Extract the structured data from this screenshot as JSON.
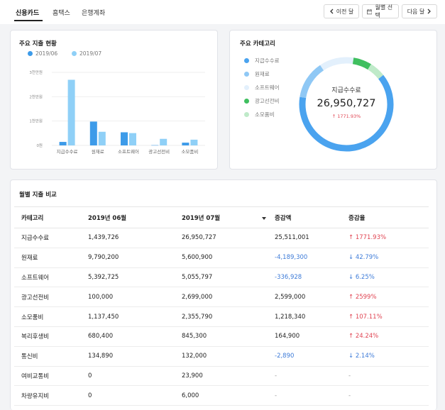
{
  "tabs": [
    {
      "label": "신용카드",
      "active": true
    },
    {
      "label": "흠택스",
      "active": false
    },
    {
      "label": "은행계좌",
      "active": false
    }
  ],
  "toolbar": {
    "prev_label": "이전 달",
    "month_select_label": "월별 선택",
    "next_label": "다음 달",
    "prev_icon": "chevron-left-icon",
    "calendar_icon": "calendar-icon",
    "next_icon": "chevron-right-icon"
  },
  "spending_card": {
    "title": "주요 지출 현황",
    "chart_data": {
      "type": "bar",
      "title": "주요 지출 현황",
      "categories": [
        "지급수수료",
        "원재료",
        "소프트웨어",
        "광고선전비",
        "소모품비"
      ],
      "series": [
        {
          "name": "2019/06",
          "color": "#3d9be9",
          "values": [
            1439726,
            9790200,
            5392725,
            100000,
            1137450
          ]
        },
        {
          "name": "2019/07",
          "color": "#8fd0f7",
          "values": [
            26950727,
            5600900,
            5055797,
            2699000,
            2355790
          ]
        }
      ],
      "y_ticks": [
        {
          "value": 0,
          "label": "0원"
        },
        {
          "value": 10000000,
          "label": "1천만원"
        },
        {
          "value": 20000000,
          "label": "2천만원"
        },
        {
          "value": 30000000,
          "label": "3천만원"
        }
      ],
      "ylim": [
        0,
        30000000
      ],
      "grid": true,
      "legend": "top-left"
    }
  },
  "category_card": {
    "title": "주요 카테고리",
    "items": [
      {
        "label": "지급수수료",
        "color": "#4aa3ef"
      },
      {
        "label": "원재료",
        "color": "#8fc8f5"
      },
      {
        "label": "소프트웨어",
        "color": "#e3f0fc"
      },
      {
        "label": "광고선전비",
        "color": "#3fbf5f"
      },
      {
        "label": "소모품비",
        "color": "#bfeac9"
      }
    ],
    "center_label": "지급수수료",
    "center_value": "26,950,727",
    "center_change": "↑ 1771.93%",
    "chart_data": {
      "type": "pie",
      "categories": [
        "지급수수료",
        "원재료",
        "소프트웨어",
        "광고선전비",
        "소모품비"
      ],
      "values": [
        26950727,
        5600900,
        5055797,
        2699000,
        2355790
      ],
      "colors": [
        "#4aa3ef",
        "#8fc8f5",
        "#e3f0fc",
        "#3fbf5f",
        "#bfeac9"
      ]
    }
  },
  "compare_card": {
    "title": "월별 지출 비교",
    "headers": [
      "카테고리",
      "2019년 06월",
      "2019년 07월",
      "증감액",
      "증감율"
    ],
    "sort_icon": "caret-down-icon",
    "rows": [
      {
        "category": "지급수수료",
        "jun": "1,439,726",
        "jul": "26,950,727",
        "diff": "25,511,001",
        "diff_neg": false,
        "rate": "↑ 1771.93%",
        "rate_dir": "up"
      },
      {
        "category": "원재료",
        "jun": "9,790,200",
        "jul": "5,600,900",
        "diff": "-4,189,300",
        "diff_neg": true,
        "rate": "↓ 42.79%",
        "rate_dir": "down"
      },
      {
        "category": "소프트웨어",
        "jun": "5,392,725",
        "jul": "5,055,797",
        "diff": "-336,928",
        "diff_neg": true,
        "rate": "↓ 6.25%",
        "rate_dir": "down"
      },
      {
        "category": "광고선전비",
        "jun": "100,000",
        "jul": "2,699,000",
        "diff": "2,599,000",
        "diff_neg": false,
        "rate": "↑ 2599%",
        "rate_dir": "up"
      },
      {
        "category": "소모품비",
        "jun": "1,137,450",
        "jul": "2,355,790",
        "diff": "1,218,340",
        "diff_neg": false,
        "rate": "↑ 107.11%",
        "rate_dir": "up"
      },
      {
        "category": "복리후생비",
        "jun": "680,400",
        "jul": "845,300",
        "diff": "164,900",
        "diff_neg": false,
        "rate": "↑ 24.24%",
        "rate_dir": "up"
      },
      {
        "category": "통신비",
        "jun": "134,890",
        "jul": "132,000",
        "diff": "-2,890",
        "diff_neg": true,
        "rate": "↓ 2.14%",
        "rate_dir": "down"
      },
      {
        "category": "여비교통비",
        "jun": "0",
        "jul": "23,900",
        "diff": "-",
        "diff_neg": false,
        "rate": "-",
        "rate_dir": "none"
      },
      {
        "category": "차량유지비",
        "jun": "0",
        "jul": "6,000",
        "diff": "-",
        "diff_neg": false,
        "rate": "-",
        "rate_dir": "none"
      }
    ]
  }
}
